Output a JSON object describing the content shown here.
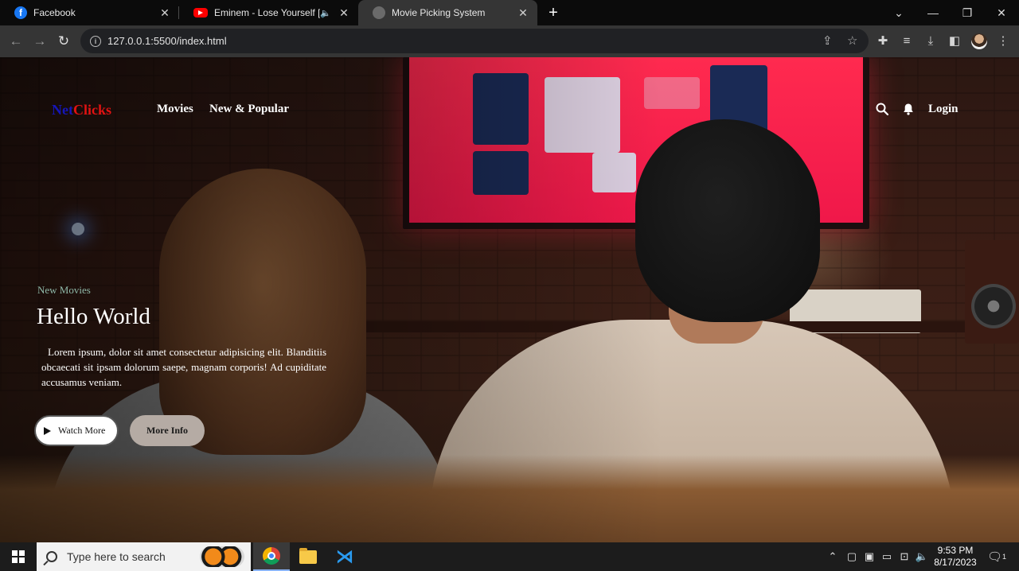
{
  "browser": {
    "tabs": [
      {
        "title": "Facebook",
        "favicon": "facebook-icon",
        "active": false
      },
      {
        "title": "Eminem - Lose Yourself [HD]",
        "favicon": "youtube-icon",
        "active": false,
        "audio": true
      },
      {
        "title": "Movie Picking System",
        "favicon": "globe-icon",
        "active": true
      }
    ],
    "new_tab_label": "+",
    "url": "127.0.0.1:5500/index.html"
  },
  "site": {
    "logo_part1": "Net",
    "logo_part2": "Clicks",
    "nav": [
      "Movies",
      "New & Popular"
    ],
    "login_label": "Login",
    "hero": {
      "eyebrow": "New Movies",
      "title": "Hello World",
      "description": "Lorem ipsum, dolor sit amet consectetur adipisicing elit. Blanditiis obcaecati sit ipsam dolorum saepe, magnam corporis! Ad cupiditate accusamus veniam.",
      "watch_label": "Watch More",
      "info_label": "More Info"
    },
    "colors": {
      "logo_primary": "#1616b8",
      "logo_accent": "#e01212"
    }
  },
  "taskbar": {
    "search_placeholder": "Type here to search",
    "time": "9:53 PM",
    "date": "8/17/2023",
    "notification_count": "1"
  }
}
